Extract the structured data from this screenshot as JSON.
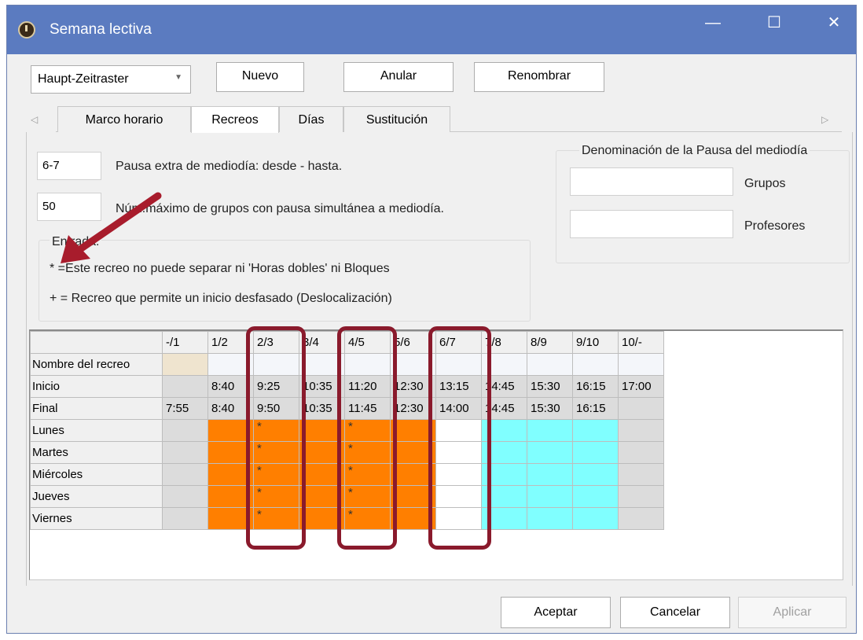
{
  "window": {
    "title": "Semana lectiva",
    "minimize": "—",
    "maximize": "☐",
    "close": "✕"
  },
  "toolbar": {
    "schedule_select": "Haupt-Zeitraster",
    "new_label": "Nuevo",
    "cancel_label": "Anular",
    "rename_label": "Renombrar"
  },
  "tabs": [
    {
      "label": "Marco horario"
    },
    {
      "label": "Recreos"
    },
    {
      "label": "Días"
    },
    {
      "label": "Sustitución"
    }
  ],
  "tab_arrows": {
    "left": "◁",
    "right": "▷"
  },
  "form": {
    "extra_pause_value": "6-7",
    "extra_pause_label": "Pausa extra de mediodía: desde - hasta.",
    "max_groups_value": "50",
    "max_groups_label": "Núm.máximo de grupos con pausa simultánea a mediodía.",
    "legend_title": "Entrada:",
    "legend_line1": "* =Este recreo no puede separar ni 'Horas dobles' ni Bloques",
    "legend_line2": "+ = Recreo que permite un inicio desfasado (Deslocalización)",
    "denomination_title": "Denominación de la Pausa del mediodía",
    "groups_label": "Grupos",
    "teachers_label": "Profesores",
    "groups_value": "",
    "teachers_value": ""
  },
  "grid": {
    "columns": [
      "",
      "-/1",
      "1/2",
      "2/3",
      "3/4",
      "4/5",
      "5/6",
      "6/7",
      "7/8",
      "8/9",
      "9/10",
      "10/-"
    ],
    "rows": [
      {
        "label": "Nombre del recreo",
        "cells": [
          "",
          "",
          "",
          "",
          "",
          "",
          "",
          "",
          "",
          "",
          ""
        ]
      },
      {
        "label": "Inicio",
        "cells": [
          "",
          "8:40",
          "9:25",
          "10:35",
          "11:20",
          "12:30",
          "13:15",
          "14:45",
          "15:30",
          "16:15",
          "17:00"
        ]
      },
      {
        "label": "Final",
        "cells": [
          "7:55",
          "8:40",
          "9:50",
          "10:35",
          "11:45",
          "12:30",
          "14:00",
          "14:45",
          "15:30",
          "16:15",
          ""
        ]
      },
      {
        "label": "Lunes",
        "cells": [
          "",
          "",
          "*",
          "",
          "*",
          "",
          "",
          "",
          "",
          "",
          ""
        ]
      },
      {
        "label": "Martes",
        "cells": [
          "",
          "",
          "*",
          "",
          "*",
          "",
          "",
          "",
          "",
          "",
          ""
        ]
      },
      {
        "label": "Miércoles",
        "cells": [
          "",
          "",
          "*",
          "",
          "*",
          "",
          "",
          "",
          "",
          "",
          ""
        ]
      },
      {
        "label": "Jueves",
        "cells": [
          "",
          "",
          "*",
          "",
          "*",
          "",
          "",
          "",
          "",
          "",
          ""
        ]
      },
      {
        "label": "Viernes",
        "cells": [
          "",
          "",
          "*",
          "",
          "*",
          "",
          "",
          "",
          "",
          "",
          ""
        ]
      }
    ],
    "colors": {
      "orange": "#ff7f00",
      "cyan": "#80ffff",
      "gray": "#dcdcdc",
      "highlight": "#8a1a2c"
    }
  },
  "footer": {
    "accept_label": "Aceptar",
    "cancel_label": "Cancelar",
    "apply_label": "Aplicar"
  }
}
